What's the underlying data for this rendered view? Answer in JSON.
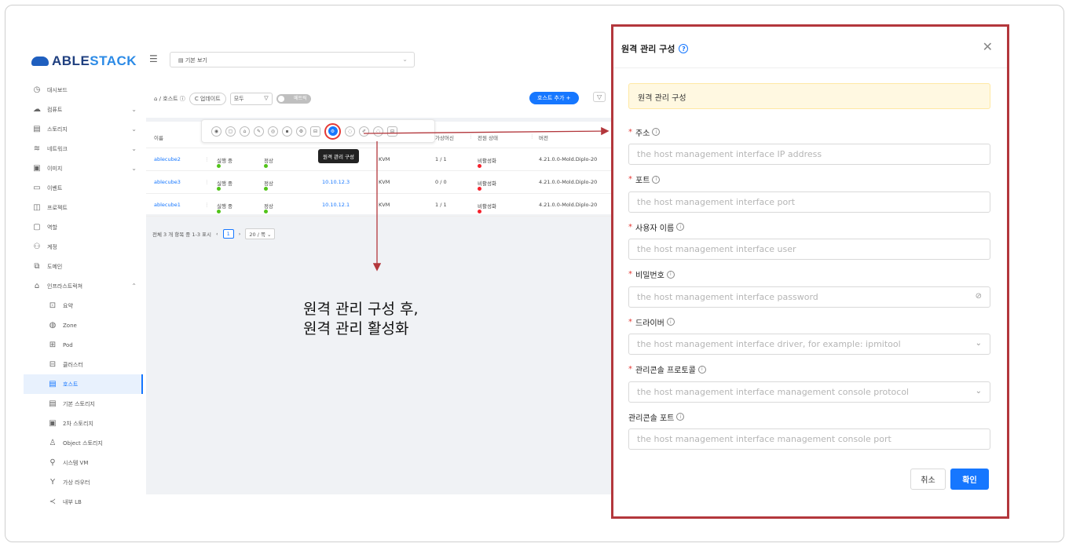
{
  "logo": {
    "text_main": "ABLE",
    "text_accent": "STACK"
  },
  "sidebar": {
    "items": [
      {
        "icon": "dashboard-icon",
        "glyph": "◷",
        "label": "대시보드",
        "chevron": ""
      },
      {
        "icon": "compute-icon",
        "glyph": "☁",
        "label": "컴퓨트",
        "chevron": "⌄"
      },
      {
        "icon": "storage-icon",
        "glyph": "▤",
        "label": "스토리지",
        "chevron": "⌄"
      },
      {
        "icon": "network-icon",
        "glyph": "≋",
        "label": "네트워크",
        "chevron": "⌄"
      },
      {
        "icon": "image-icon",
        "glyph": "▣",
        "label": "이미지",
        "chevron": "⌄"
      },
      {
        "icon": "event-icon",
        "glyph": "▭",
        "label": "이벤트",
        "chevron": ""
      },
      {
        "icon": "project-icon",
        "glyph": "◫",
        "label": "프로젝트",
        "chevron": ""
      },
      {
        "icon": "role-icon",
        "glyph": "▢",
        "label": "역할",
        "chevron": ""
      },
      {
        "icon": "account-icon",
        "glyph": "⚇",
        "label": "계정",
        "chevron": ""
      },
      {
        "icon": "domain-icon",
        "glyph": "⧉",
        "label": "도메인",
        "chevron": ""
      },
      {
        "icon": "infrastructure-icon",
        "glyph": "⌂",
        "label": "인프라스트럭쳐",
        "chevron": "⌃"
      }
    ],
    "sub_items": [
      {
        "icon": "summary-icon",
        "glyph": "⊡",
        "label": "요약"
      },
      {
        "icon": "zone-icon",
        "glyph": "◍",
        "label": "Zone"
      },
      {
        "icon": "pod-icon",
        "glyph": "⊞",
        "label": "Pod"
      },
      {
        "icon": "cluster-icon",
        "glyph": "⊟",
        "label": "클러스터"
      },
      {
        "icon": "host-icon",
        "glyph": "▤",
        "label": "호스트",
        "active": true
      },
      {
        "icon": "primary-storage-icon",
        "glyph": "▤",
        "label": "기본 스토리지"
      },
      {
        "icon": "secondary-storage-icon",
        "glyph": "▣",
        "label": "2차 스토리지"
      },
      {
        "icon": "object-storage-icon",
        "glyph": "♙",
        "label": "Object 스토리지"
      },
      {
        "icon": "system-vm-icon",
        "glyph": "⚲",
        "label": "시스템 VM"
      },
      {
        "icon": "virtual-router-icon",
        "glyph": "Y",
        "label": "가상 라우터"
      },
      {
        "icon": "internal-lb-icon",
        "glyph": "≺",
        "label": "내부 LB"
      }
    ]
  },
  "topbar": {
    "view_label": "기본 보기"
  },
  "breadcrumb": {
    "text": "⌂ / 호스트 ⓘ",
    "refresh": "C 업데이트",
    "filter_value": "모두",
    "toggle_label": "메트릭"
  },
  "buttons": {
    "add_host": "호스트 추가 +",
    "filter": "▽"
  },
  "table": {
    "headers": [
      "이름",
      "가상머신",
      "전원 상태",
      "버전"
    ],
    "rows": [
      {
        "name": "ablecube2",
        "state": "실행 중",
        "resource": "정상",
        "ip": "",
        "hypervisor": "KVM",
        "vms": "1 / 1",
        "power": "비활성화",
        "version": "4.21.0.0-Mold.Diplo-20"
      },
      {
        "name": "ablecube3",
        "state": "실행 중",
        "resource": "정상",
        "ip": "10.10.12.3",
        "hypervisor": "KVM",
        "vms": "0 / 0",
        "power": "비활성화",
        "version": "4.21.0.0-Mold.Diplo-20"
      },
      {
        "name": "ablecube1",
        "state": "실행 중",
        "resource": "정상",
        "ip": "10.10.12.1",
        "hypervisor": "KVM",
        "vms": "1 / 1",
        "power": "비활성화",
        "version": "4.21.0.0-Mold.Diplo-20"
      }
    ]
  },
  "tooltip": "원격 관리 구성",
  "pager": {
    "summary": "전체 3 개 항목 중 1-3 표시",
    "page": "1",
    "size": "20 / 쪽"
  },
  "annotation": {
    "line1": "원격 관리 구성 후,",
    "line2": "원격 관리 활성화"
  },
  "modal": {
    "title": "원격 관리 구성",
    "alert": "원격 관리 구성",
    "fields": [
      {
        "label": "주소",
        "required": true,
        "placeholder": "the host management interface IP address",
        "suffix": ""
      },
      {
        "label": "포트",
        "required": true,
        "placeholder": "the host management interface port",
        "suffix": ""
      },
      {
        "label": "사용자 이름",
        "required": true,
        "placeholder": "the host management interface user",
        "suffix": ""
      },
      {
        "label": "비밀번호",
        "required": true,
        "placeholder": "the host management interface password",
        "suffix": "eye-off-icon"
      },
      {
        "label": "드라이버",
        "required": true,
        "placeholder": "the host management interface driver, for example: ipmitool",
        "suffix": "chevron-down-icon"
      },
      {
        "label": "관리콘솔 프로토콜",
        "required": true,
        "placeholder": "the host management interface management console protocol",
        "suffix": "chevron-down-icon"
      },
      {
        "label": "관리콘솔 포트",
        "required": false,
        "placeholder": "the host management interface management console port",
        "suffix": ""
      }
    ],
    "cancel": "취소",
    "ok": "확인"
  },
  "colors": {
    "primary": "#1677ff",
    "highlight": "#b3373c",
    "running": "#52c41a",
    "disabled": "#f5222d"
  }
}
